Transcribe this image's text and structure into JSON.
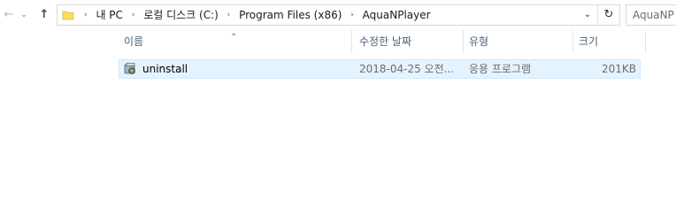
{
  "nav": {
    "back_icon": "←",
    "forward_icon": "⌄",
    "up_icon": "↑"
  },
  "address": {
    "crumbs": [
      "내 PC",
      "로컬 디스크 (C:)",
      "Program Files (x86)",
      "AquaNPlayer"
    ],
    "separator": "›",
    "dropdown_icon": "⌄",
    "refresh_icon": "↻"
  },
  "search": {
    "text": "AquaNP"
  },
  "columns": {
    "name": "이름",
    "date": "수정한 날짜",
    "type": "유형",
    "size": "크기",
    "sort_icon": "⌃"
  },
  "files": [
    {
      "name": "uninstall",
      "date": "2018-04-25 오전...",
      "type": "응용 프로그램",
      "size": "201KB",
      "icon": "uninstaller-app-icon"
    }
  ],
  "colors": {
    "selection_bg": "#e5f3ff",
    "selection_border": "#cce8ff",
    "header_text": "#4c607a",
    "folder": "#ffd966"
  }
}
